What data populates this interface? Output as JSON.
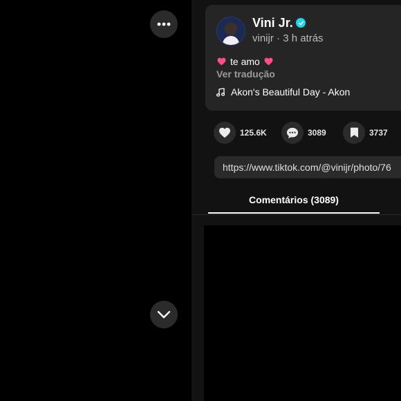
{
  "colors": {
    "background": "#000000",
    "panel": "#121212",
    "card": "#252525",
    "verified": "#20d5ec",
    "heart_emoji": "#ff4d8d"
  },
  "media_controls": {
    "more_icon": "more-horizontal-icon",
    "next_icon": "chevron-down-icon"
  },
  "post": {
    "username": "Vini Jr.",
    "handle": "vinijr",
    "separator": " · ",
    "time_ago": "3 h atrás",
    "caption_text": "te amo",
    "translate_link": "Ver tradução",
    "music": "Akon's Beautiful Day - Akon"
  },
  "stats": {
    "likes": "125.6K",
    "comments": "3089",
    "saves": "3737"
  },
  "share": {
    "url": "https://www.tiktok.com/@vinijr/photo/76"
  },
  "tabs": {
    "comments_label": "Comentários (3089)"
  }
}
